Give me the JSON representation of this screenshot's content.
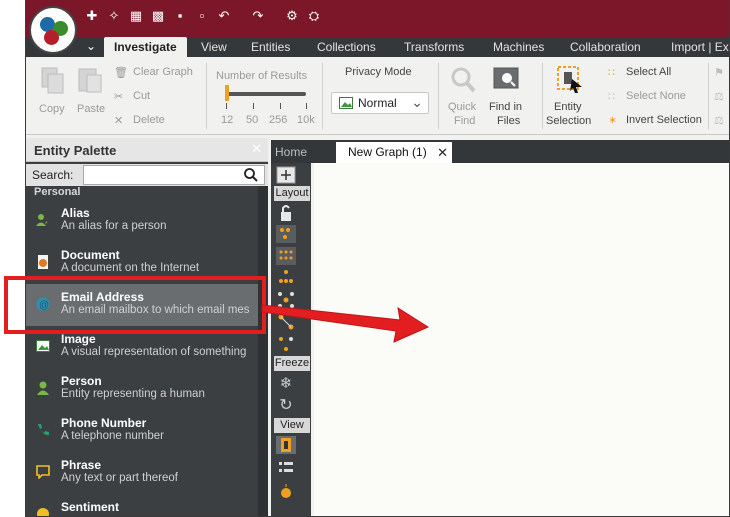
{
  "toolbar_tabs": {
    "investigate": "Investigate",
    "view": "View",
    "entities": "Entities",
    "collections": "Collections",
    "transforms": "Transforms",
    "machines": "Machines",
    "collaboration": "Collaboration",
    "import_export": "Import | Ex"
  },
  "ribbon": {
    "copy": "Copy",
    "paste": "Paste",
    "clear_graph": "Clear Graph",
    "cut": "Cut",
    "delete": "Delete",
    "number_of_results": "Number of Results",
    "ticks": [
      "12",
      "50",
      "256",
      "10k"
    ],
    "privacy_mode": "Privacy Mode",
    "privacy_value": "Normal",
    "quick_find_1": "Quick",
    "quick_find_2": "Find",
    "find_files_1": "Find in",
    "find_files_2": "Files",
    "entity_sel_1": "Entity",
    "entity_sel_2": "Selection",
    "select_all": "Select All",
    "select_none": "Select None",
    "invert_selection": "Invert Selection"
  },
  "palette": {
    "title": "Entity Palette",
    "search_label": "Search:",
    "search_value": "",
    "group": "Personal",
    "entities": [
      {
        "name": "Alias",
        "desc": "An alias for a person"
      },
      {
        "name": "Document",
        "desc": "A document on the Internet"
      },
      {
        "name": "Email Address",
        "desc": "An email mailbox to which email mes"
      },
      {
        "name": "Image",
        "desc": "A visual representation of something"
      },
      {
        "name": "Person",
        "desc": "Entity representing a human"
      },
      {
        "name": "Phone Number",
        "desc": "A telephone number"
      },
      {
        "name": "Phrase",
        "desc": "Any text or part thereof"
      },
      {
        "name": "Sentiment",
        "desc": ""
      }
    ]
  },
  "graph": {
    "home_tab": "Home",
    "active_tab": "New Graph (1)",
    "sections": {
      "layout": "Layout",
      "freeze": "Freeze",
      "view": "View"
    }
  },
  "colors": {
    "title_bar": "#7b1728",
    "dark_panel": "#3b3f42",
    "highlight": "#e21e21",
    "accent": "#f0a020"
  }
}
